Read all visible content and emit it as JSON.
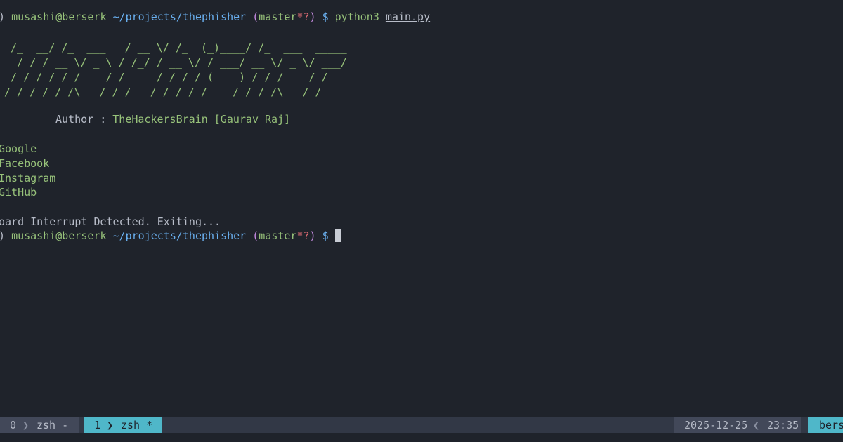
{
  "prompt": {
    "user_host": "musashi@berserk",
    "path": "~/projects/thephisher",
    "branch_open": "(",
    "branch": "master",
    "branch_flags": "*?",
    "branch_close": ")",
    "symbol": "$",
    "leading": ")"
  },
  "command": {
    "program": "python3",
    "script": "main.py"
  },
  "banner": {
    "art": "  ________         ____  __     _      __\n /_  __/ /_  ___   / __ \\/ /_  (_)____/ /_  ___  _____\n  / / / __ \\/ _ \\ / /_/ / __ \\/ / ___/ __ \\/ _ \\/ ___/\n / / / / / /  __/ / ____/ / / / (__  ) / / /  __/ /\n/_/ /_/ /_/\\___/ /_/   /_/ /_/_/____/_/ /_/\\___/_/"
  },
  "author": {
    "label": "Author : ",
    "value": "TheHackersBrain [Gaurav Raj]"
  },
  "menu": {
    "items": [
      "Google",
      "Facebook",
      "Instagram",
      "GitHub"
    ]
  },
  "message": "oard Interrupt Detected. Exiting...",
  "tmux": {
    "win0_index": "0",
    "win0_name": "zsh -",
    "win1_index": "1",
    "win1_name": "zsh *",
    "date": "2025-12-25",
    "time": "23:35",
    "host": "bers"
  },
  "colors": {
    "background": "#1f232b",
    "green": "#97c27a",
    "blue": "#6ab0f0",
    "purple": "#c58ae0",
    "red": "#e06c75",
    "accent": "#4fb7c9"
  }
}
